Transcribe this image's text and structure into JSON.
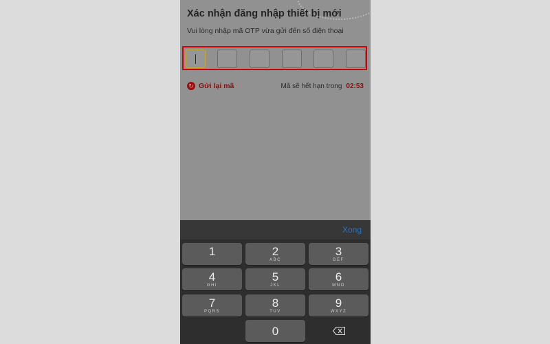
{
  "header": {
    "title": "Xác nhận đăng nhập thiết bị mới",
    "subtitle": "Vui lòng nhập mã OTP vừa gửi đến số điện thoại"
  },
  "otp": {
    "digit_count": 6,
    "active_index": 0
  },
  "resend": {
    "label": "Gửi lại mã",
    "icon": "resend-icon"
  },
  "expiry": {
    "label": "Mã sẽ hết hạn trong",
    "time": "02:53"
  },
  "keyboard": {
    "done_label": "Xong",
    "keys": [
      {
        "num": "1",
        "letters": ""
      },
      {
        "num": "2",
        "letters": "ABC"
      },
      {
        "num": "3",
        "letters": "DEF"
      },
      {
        "num": "4",
        "letters": "GHI"
      },
      {
        "num": "5",
        "letters": "JKL"
      },
      {
        "num": "6",
        "letters": "MNO"
      },
      {
        "num": "7",
        "letters": "PQRS"
      },
      {
        "num": "8",
        "letters": "TUV"
      },
      {
        "num": "9",
        "letters": "WXYZ"
      },
      {
        "num": "0",
        "letters": ""
      }
    ],
    "delete_icon": "backspace-icon"
  },
  "colors": {
    "accent_red": "#d00000",
    "brand_dark_red": "#8a1010",
    "done_blue": "#2d6fc2"
  }
}
